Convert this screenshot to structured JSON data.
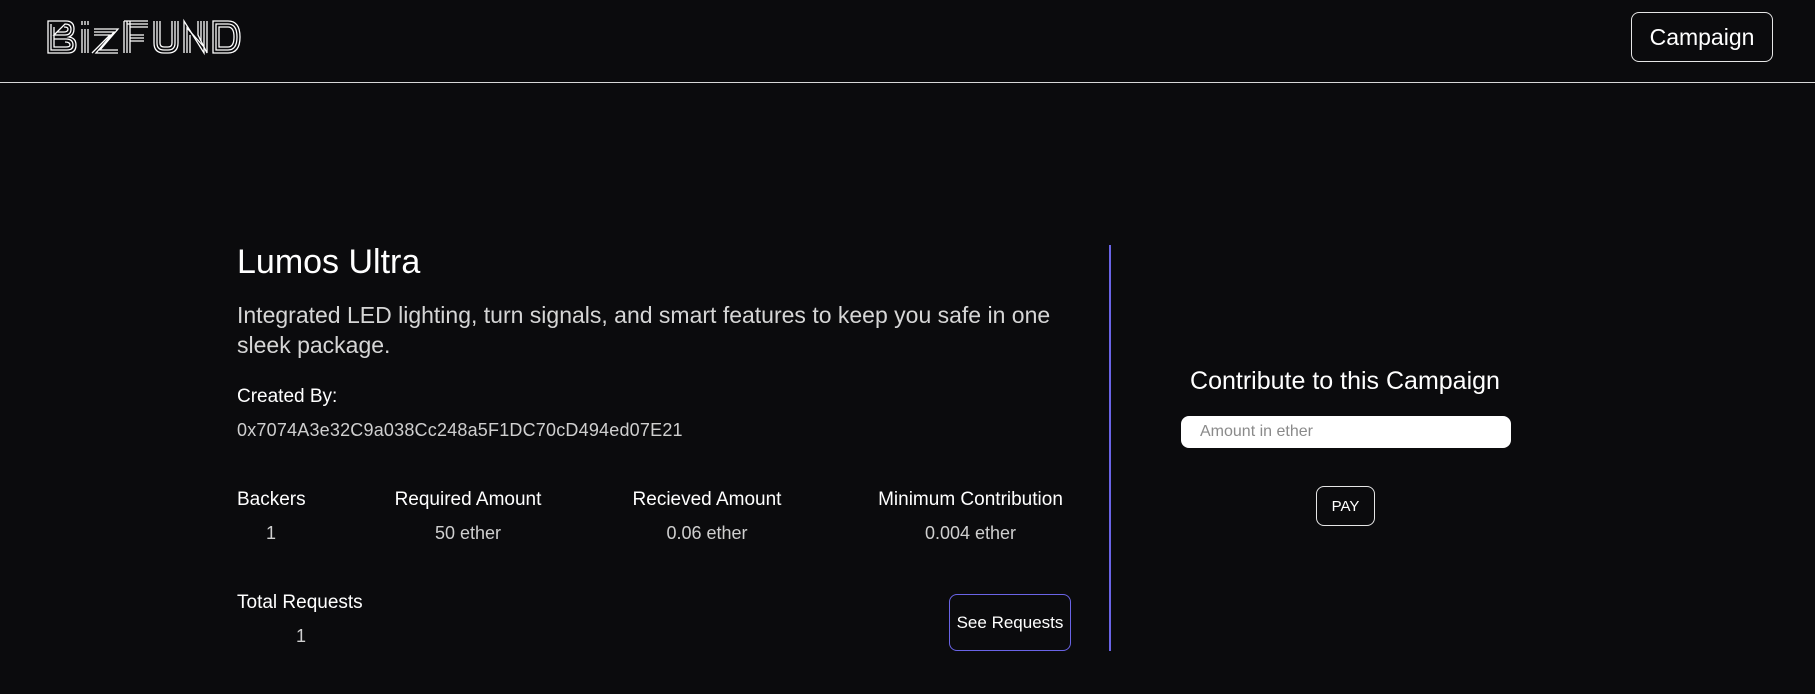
{
  "header": {
    "logo_text": "BizFund",
    "campaign_button": "Campaign"
  },
  "campaign": {
    "title": "Lumos Ultra",
    "description": "Integrated LED lighting, turn signals, and smart features to keep you safe in one sleek package.",
    "created_by_label": "Created By:",
    "creator_address": "0x7074A3e32C9a038Cc248a5F1DC70cD494ed07E21",
    "stats": {
      "backers_label": "Backers",
      "backers_value": "1",
      "required_label": "Required Amount",
      "required_value": "50 ether",
      "received_label": "Recieved Amount",
      "received_value": "0.06 ether",
      "minimum_label": "Minimum Contribution",
      "minimum_value": "0.004 ether",
      "requests_label": "Total Requests",
      "requests_value": "1"
    },
    "see_requests_button": "See Requests"
  },
  "contribute": {
    "title": "Contribute to this Campaign",
    "input_placeholder": "Amount in ether",
    "input_value": "",
    "pay_button": "PAY"
  },
  "colors": {
    "background": "#0b0b0d",
    "accent": "#6a64e6",
    "text": "#ffffff",
    "muted_text": "#cfcfcf"
  }
}
